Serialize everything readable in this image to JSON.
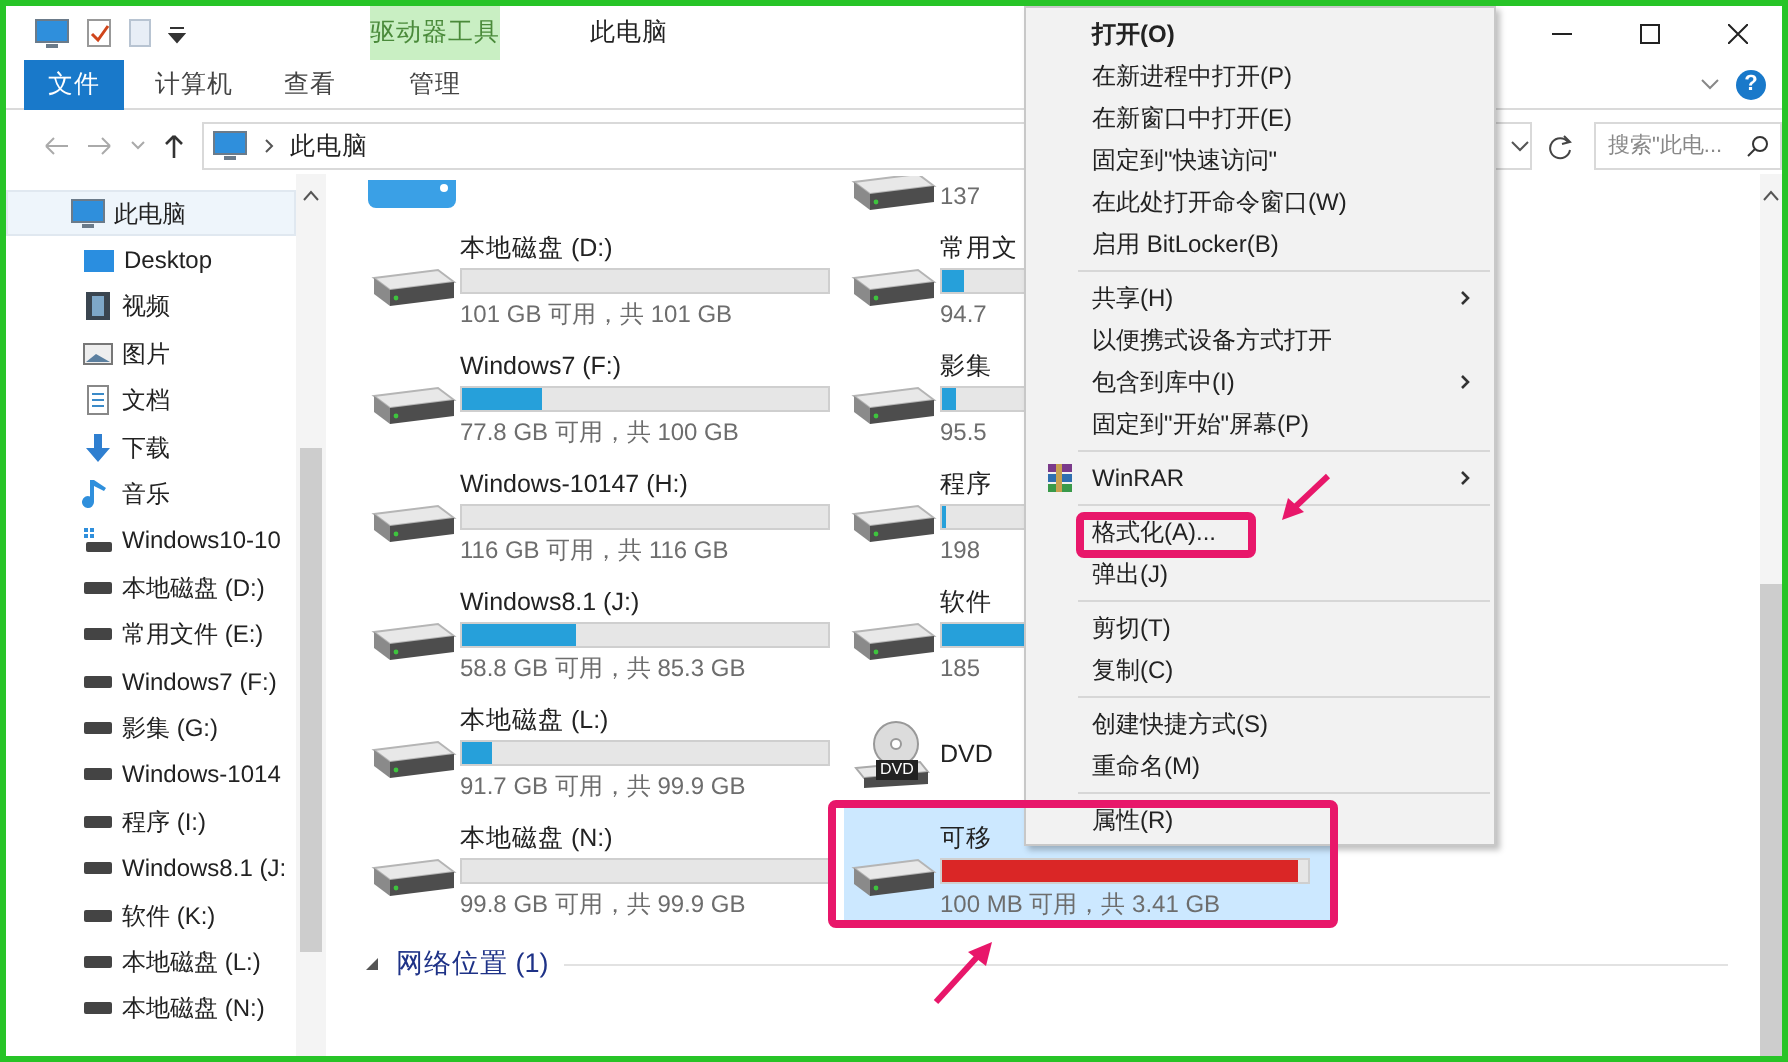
{
  "title_bar": {
    "context_tab": "驱动器工具",
    "title": "此电脑"
  },
  "ribbon": {
    "tabs": [
      {
        "label": "文件",
        "kind": "file"
      },
      {
        "label": "计算机",
        "kind": "tab"
      },
      {
        "label": "查看",
        "kind": "tab"
      },
      {
        "label": "管理",
        "kind": "context"
      }
    ],
    "help": "?"
  },
  "address_bar": {
    "path": "此电脑",
    "search": {
      "placeholder": "搜索\"此电..."
    }
  },
  "sidebar": {
    "items": [
      {
        "label": "此电脑",
        "kind": "pc",
        "selected": true,
        "children": [
          {
            "label": "Desktop",
            "kind": "desktop",
            "selected": false
          },
          {
            "label": "视频",
            "kind": "video",
            "selected": false
          },
          {
            "label": "图片",
            "kind": "pictures",
            "selected": false
          },
          {
            "label": "文档",
            "kind": "documents",
            "selected": false
          },
          {
            "label": "下载",
            "kind": "downloads",
            "selected": false
          },
          {
            "label": "音乐",
            "kind": "music",
            "selected": false
          },
          {
            "label": "Windows10-10",
            "kind": "system-drive",
            "selected": false
          },
          {
            "label": "本地磁盘 (D:)",
            "kind": "drive",
            "selected": false
          },
          {
            "label": "常用文件 (E:)",
            "kind": "drive",
            "selected": false
          },
          {
            "label": "Windows7 (F:)",
            "kind": "drive",
            "selected": false
          },
          {
            "label": "影集 (G:)",
            "kind": "drive",
            "selected": false
          },
          {
            "label": "Windows-1014",
            "kind": "drive",
            "selected": false
          },
          {
            "label": "程序 (I:)",
            "kind": "drive",
            "selected": false
          },
          {
            "label": "Windows8.1 (J:",
            "kind": "drive",
            "selected": false
          },
          {
            "label": "软件 (K:)",
            "kind": "drive",
            "selected": false
          },
          {
            "label": "本地磁盘 (L:)",
            "kind": "drive",
            "selected": false
          },
          {
            "label": "本地磁盘 (N:)",
            "kind": "drive",
            "selected": false
          }
        ]
      }
    ]
  },
  "drives": {
    "tiles": [
      {
        "kind": "folder",
        "selected": false
      },
      {
        "kind": "drive",
        "usage": "137",
        "selected": false
      },
      {
        "kind": "drive",
        "name": "本地磁盘 (D:)",
        "level": 0,
        "usage": "101 GB 可用，共 101 GB",
        "selected": false
      },
      {
        "kind": "drive",
        "name": "常用文",
        "level": 0.06,
        "usage": "94.7",
        "selected": false
      },
      {
        "kind": "drive",
        "name": "Windows7 (F:)",
        "level": 0.22,
        "usage": "77.8 GB 可用，共 100 GB",
        "selected": false
      },
      {
        "kind": "drive",
        "name": "影集",
        "level": 0.04,
        "usage": "95.5",
        "selected": false
      },
      {
        "kind": "drive",
        "name": "Windows-10147 (H:)",
        "level": 0,
        "usage": "116 GB 可用，共 116 GB",
        "selected": false
      },
      {
        "kind": "drive",
        "name": "程序",
        "level": 0.01,
        "usage": "198",
        "selected": false
      },
      {
        "kind": "drive",
        "name": "Windows8.1 (J:)",
        "level": 0.31,
        "usage": "58.8 GB 可用，共 85.3 GB",
        "selected": false
      },
      {
        "kind": "drive",
        "name": "软件",
        "level": 0.3,
        "usage": "185",
        "selected": false
      },
      {
        "kind": "drive",
        "name": "本地磁盘 (L:)",
        "level": 0.08,
        "usage": "91.7 GB 可用，共 99.9 GB",
        "selected": false
      },
      {
        "kind": "dvd",
        "name": "DVD",
        "badge": "DVD",
        "selected": false
      },
      {
        "kind": "drive",
        "name": "本地磁盘 (N:)",
        "level": 0,
        "usage": "99.8 GB 可用，共 99.9 GB",
        "selected": false
      },
      {
        "kind": "drive",
        "name": "可移",
        "level": 0.97,
        "usage": "100 MB 可用，共 3.41 GB",
        "selected": true,
        "highlighted": true
      }
    ]
  },
  "network": {
    "label": "网络位置 (1)",
    "expanded": true
  },
  "context_menu": {
    "items": [
      {
        "kind": "item",
        "label": "打开(O)",
        "default": true,
        "submenu": false
      },
      {
        "kind": "item",
        "label": "在新进程中打开(P)",
        "default": false,
        "submenu": false
      },
      {
        "kind": "item",
        "label": "在新窗口中打开(E)",
        "default": false,
        "submenu": false
      },
      {
        "kind": "item",
        "label": "固定到\"快速访问\"",
        "default": false,
        "submenu": false
      },
      {
        "kind": "item",
        "label": "在此处打开命令窗口(W)",
        "default": false,
        "submenu": false
      },
      {
        "kind": "item",
        "label": "启用 BitLocker(B)",
        "default": false,
        "submenu": false
      },
      {
        "kind": "separator"
      },
      {
        "kind": "item",
        "label": "共享(H)",
        "default": false,
        "submenu": true
      },
      {
        "kind": "item",
        "label": "以便携式设备方式打开",
        "default": false,
        "submenu": false
      },
      {
        "kind": "item",
        "label": "包含到库中(I)",
        "default": false,
        "submenu": true
      },
      {
        "kind": "item",
        "label": "固定到\"开始\"屏幕(P)",
        "default": false,
        "submenu": false
      },
      {
        "kind": "separator"
      },
      {
        "kind": "item",
        "label": "WinRAR",
        "default": false,
        "submenu": true,
        "app_icon": true
      },
      {
        "kind": "separator"
      },
      {
        "kind": "item",
        "label": "格式化(A)...",
        "default": false,
        "submenu": false,
        "highlighted": true
      },
      {
        "kind": "item",
        "label": "弹出(J)",
        "default": false,
        "submenu": false
      },
      {
        "kind": "separator"
      },
      {
        "kind": "item",
        "label": "剪切(T)",
        "default": false,
        "submenu": false
      },
      {
        "kind": "item",
        "label": "复制(C)",
        "default": false,
        "submenu": false
      },
      {
        "kind": "separator"
      },
      {
        "kind": "item",
        "label": "创建快捷方式(S)",
        "default": false,
        "submenu": false
      },
      {
        "kind": "item",
        "label": "重命名(M)",
        "default": false,
        "submenu": false
      },
      {
        "kind": "separator"
      },
      {
        "kind": "item",
        "label": "属性(R)",
        "default": false,
        "submenu": false,
        "highlighted": true
      }
    ]
  }
}
